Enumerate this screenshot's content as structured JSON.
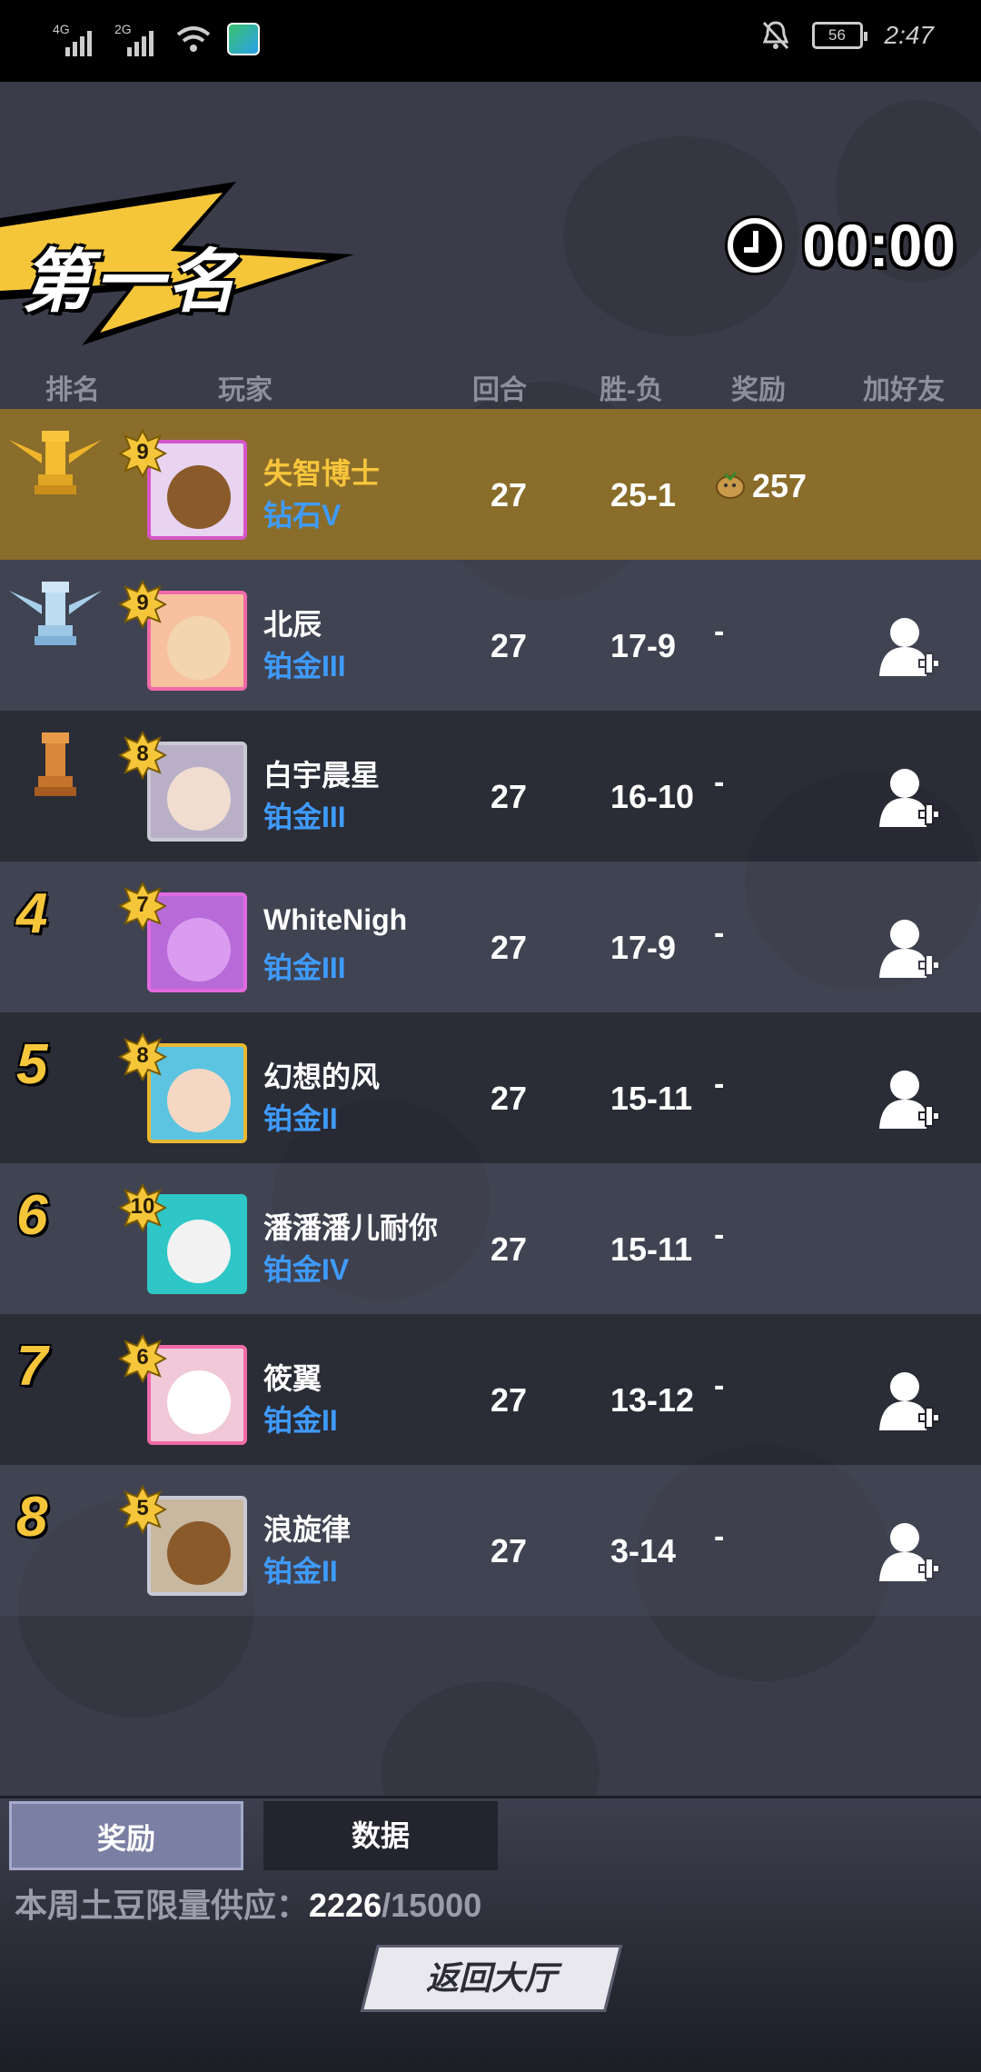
{
  "status_bar": {
    "signal1": "4G",
    "signal2": "2G",
    "battery": "56",
    "time": "2:47"
  },
  "header": {
    "rank_title": "第一名",
    "timer": "00:00"
  },
  "columns": {
    "rank": "排名",
    "player": "玩家",
    "rounds": "回合",
    "record": "胜-负",
    "reward": "奖励",
    "add_friend": "加好友"
  },
  "rows": [
    {
      "rank": "1",
      "level": "9",
      "name": "失智博士",
      "tier": "钻石V",
      "rounds": "27",
      "record": "25-1",
      "reward": "257",
      "add_friend": false
    },
    {
      "rank": "2",
      "level": "9",
      "name": "北辰",
      "tier": "铂金III",
      "rounds": "27",
      "record": "17-9",
      "reward": "-",
      "add_friend": true
    },
    {
      "rank": "3",
      "level": "8",
      "name": "白宇晨星",
      "tier": "铂金III",
      "rounds": "27",
      "record": "16-10",
      "reward": "-",
      "add_friend": true
    },
    {
      "rank": "4",
      "level": "7",
      "name": "WhiteNigh",
      "tier": "铂金III",
      "rounds": "27",
      "record": "17-9",
      "reward": "-",
      "add_friend": true
    },
    {
      "rank": "5",
      "level": "8",
      "name": "幻想的风",
      "tier": "铂金II",
      "rounds": "27",
      "record": "15-11",
      "reward": "-",
      "add_friend": true
    },
    {
      "rank": "6",
      "level": "10",
      "name": "潘潘潘儿耐你",
      "tier": "铂金IV",
      "rounds": "27",
      "record": "15-11",
      "reward": "-",
      "add_friend": false
    },
    {
      "rank": "7",
      "level": "6",
      "name": "筱翼",
      "tier": "铂金II",
      "rounds": "27",
      "record": "13-12",
      "reward": "-",
      "add_friend": true
    },
    {
      "rank": "8",
      "level": "5",
      "name": "浪旋律",
      "tier": "铂金II",
      "rounds": "27",
      "record": "3-14",
      "reward": "-",
      "add_friend": true
    }
  ],
  "tabs": {
    "reward": "奖励",
    "data": "数据"
  },
  "supply": {
    "label": "本周土豆限量供应：",
    "current": "2226",
    "total": "/15000"
  },
  "back_button": "返回大厅",
  "colors": {
    "gold": "#f7c53b",
    "tier_blue": "#3f9bff",
    "first_row": "#8a6d2a"
  }
}
